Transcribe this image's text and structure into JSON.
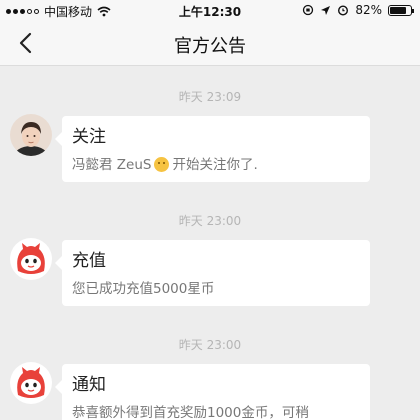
{
  "status_bar": {
    "carrier": "中国移动",
    "time": "上午12:30",
    "battery": "82%",
    "battery_level": 0.82
  },
  "header": {
    "title": "官方公告"
  },
  "messages": [
    {
      "time": "昨天 23:09",
      "title": "关注",
      "body_before": "冯懿君 ZeuS",
      "body_after": "开始关注你了.",
      "avatar": "user-photo"
    },
    {
      "time": "昨天 23:00",
      "title": "充值",
      "body_before": "您已成功充值5000星币",
      "avatar": "red-mascot"
    },
    {
      "time": "昨天 23:00",
      "title": "通知",
      "body_before": "恭喜额外得到首充奖励1000金币，可稍",
      "avatar": "red-mascot"
    }
  ],
  "colors": {
    "background": "#ededed",
    "bubble": "#ffffff",
    "mascot_red": "#e8413a"
  }
}
